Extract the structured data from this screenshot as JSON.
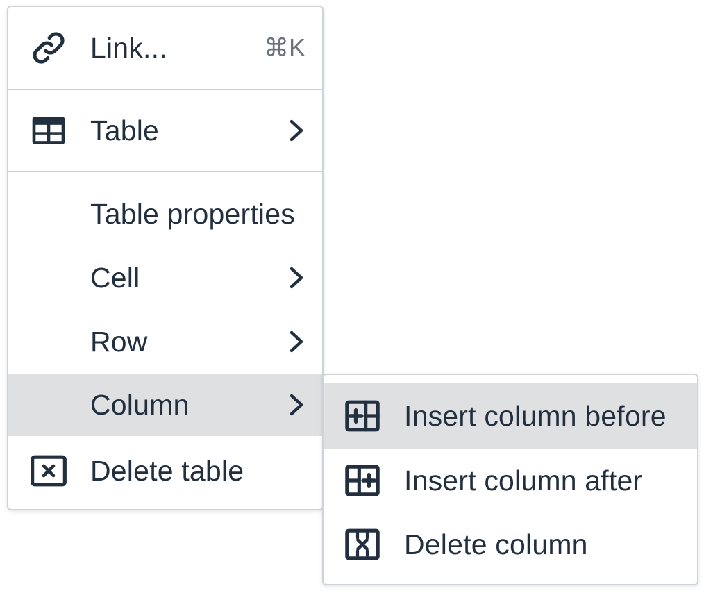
{
  "main_menu": {
    "link": {
      "label": "Link...",
      "shortcut": "⌘K",
      "icon": "link-icon"
    },
    "table": {
      "label": "Table",
      "icon": "table-icon"
    },
    "table_properties": {
      "label": "Table properties"
    },
    "cell": {
      "label": "Cell"
    },
    "row": {
      "label": "Row"
    },
    "column": {
      "label": "Column",
      "active": true
    },
    "delete_table": {
      "label": "Delete table",
      "icon": "delete-table-icon"
    }
  },
  "column_submenu": {
    "insert_before": {
      "label": "Insert column before",
      "icon": "insert-column-before-icon",
      "active": true
    },
    "insert_after": {
      "label": "Insert column after",
      "icon": "insert-column-after-icon"
    },
    "delete_column": {
      "label": "Delete column",
      "icon": "delete-column-icon"
    }
  },
  "colors": {
    "text": "#222f3e",
    "hover_background": "#dee0e2",
    "border": "#cfd3d7",
    "shortcut_text": "#6a737e"
  }
}
